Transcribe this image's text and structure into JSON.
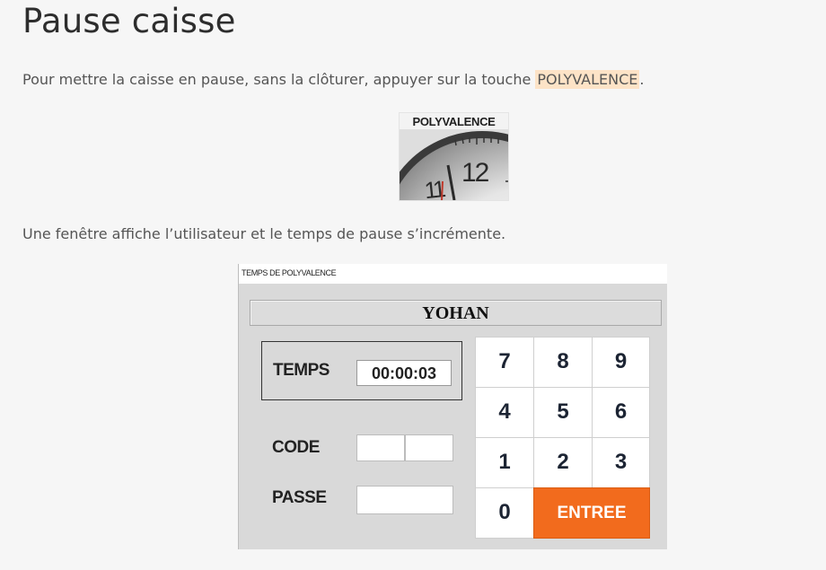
{
  "page": {
    "title": "Pause caisse",
    "intro_before": "Pour mettre la caisse en pause, sans la clôturer, appuyer sur la touche ",
    "intro_key": "POLYVALENCE",
    "intro_after": ".",
    "window_text": "Une fenêtre affiche l’utilisateur et le temps de pause s’incrémente."
  },
  "poly_key": {
    "label": "POLYVALENCE",
    "icon": "clock-icon",
    "clock_text": "11\\12"
  },
  "window": {
    "title": "TEMPS DE POLYVALENCE",
    "user": "YOHAN",
    "temps_label": "TEMPS",
    "temps_value": "00:00:03",
    "code_label": "CODE",
    "passe_label": "PASSE",
    "code_value": "",
    "passe_value": ""
  },
  "keypad": {
    "k7": "7",
    "k8": "8",
    "k9": "9",
    "k4": "4",
    "k5": "5",
    "k6": "6",
    "k1": "1",
    "k2": "2",
    "k3": "3",
    "k0": "0",
    "enter": "ENTREE",
    "enter_color": "#f26b1d"
  }
}
